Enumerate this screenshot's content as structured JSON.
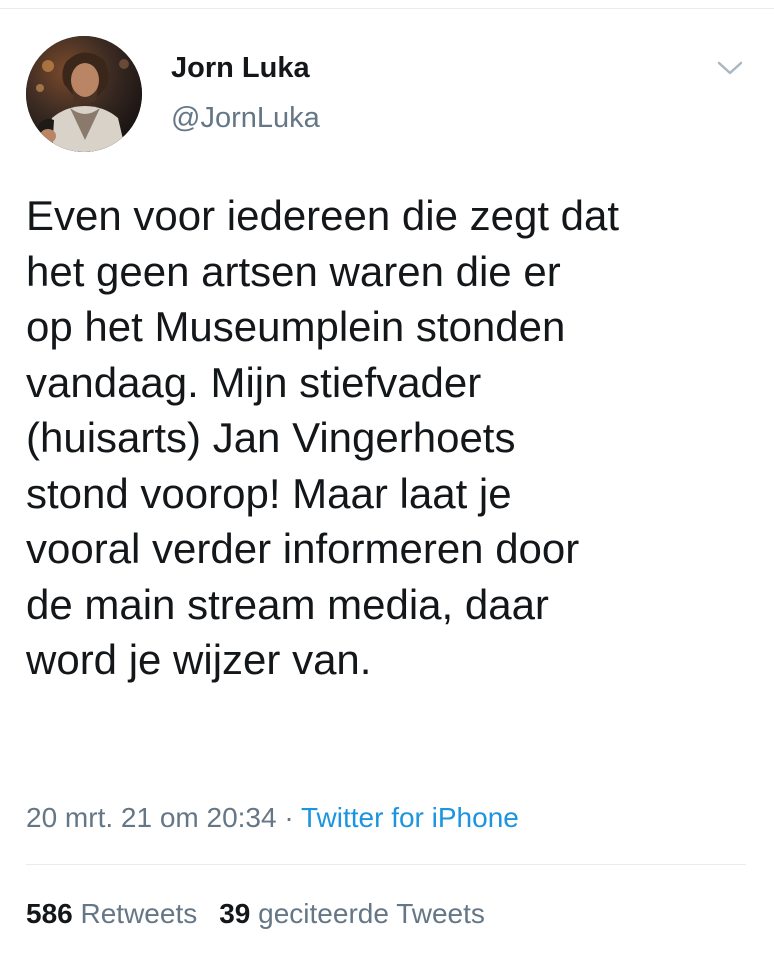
{
  "user": {
    "display_name": "Jorn Luka",
    "handle": "@JornLuka"
  },
  "tweet": {
    "text": "Even voor iedereen die zegt dat\nhet geen artsen waren die er\nop het Museumplein stonden\nvandaag. Mijn stiefvader\n(huisarts) Jan Vingerhoets\nstond voorop! Maar laat je\nvooral verder informeren door\nde main stream media, daar\nword je wijzer van.",
    "timestamp": "20 mrt. 21 om 20:34",
    "separator": "·",
    "source": "Twitter for iPhone"
  },
  "stats": {
    "retweets_count": "586",
    "retweets_label": "Retweets",
    "quotes_count": "39",
    "quotes_label": "geciteerde Tweets"
  },
  "icons": {
    "menu": "chevron-down-icon"
  },
  "colors": {
    "text_primary": "#14171a",
    "text_secondary": "#657786",
    "link": "#1b95e0",
    "divider": "#e6ecf0"
  }
}
